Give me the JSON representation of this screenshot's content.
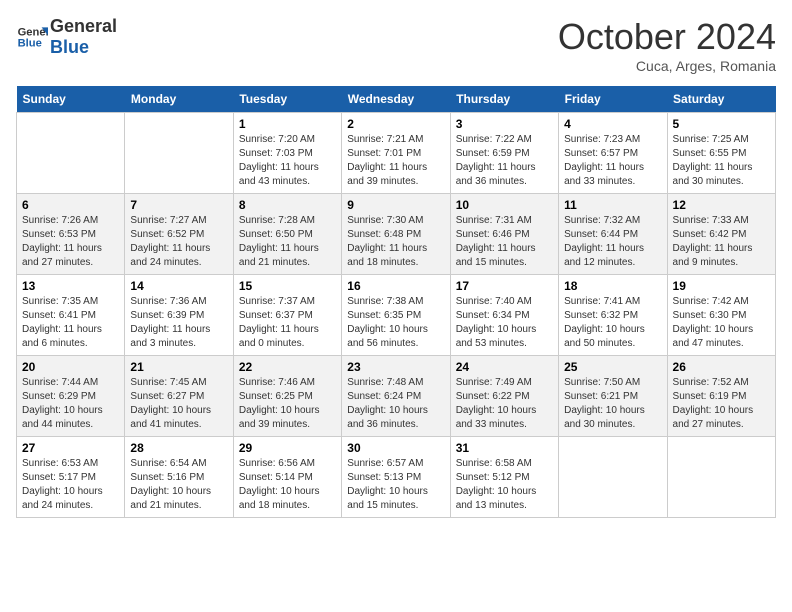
{
  "logo": {
    "line1": "General",
    "line2": "Blue"
  },
  "title": "October 2024",
  "subtitle": "Cuca, Arges, Romania",
  "days_of_week": [
    "Sunday",
    "Monday",
    "Tuesday",
    "Wednesday",
    "Thursday",
    "Friday",
    "Saturday"
  ],
  "weeks": [
    [
      {
        "num": "",
        "sunrise": "",
        "sunset": "",
        "daylight": ""
      },
      {
        "num": "",
        "sunrise": "",
        "sunset": "",
        "daylight": ""
      },
      {
        "num": "1",
        "sunrise": "Sunrise: 7:20 AM",
        "sunset": "Sunset: 7:03 PM",
        "daylight": "Daylight: 11 hours and 43 minutes."
      },
      {
        "num": "2",
        "sunrise": "Sunrise: 7:21 AM",
        "sunset": "Sunset: 7:01 PM",
        "daylight": "Daylight: 11 hours and 39 minutes."
      },
      {
        "num": "3",
        "sunrise": "Sunrise: 7:22 AM",
        "sunset": "Sunset: 6:59 PM",
        "daylight": "Daylight: 11 hours and 36 minutes."
      },
      {
        "num": "4",
        "sunrise": "Sunrise: 7:23 AM",
        "sunset": "Sunset: 6:57 PM",
        "daylight": "Daylight: 11 hours and 33 minutes."
      },
      {
        "num": "5",
        "sunrise": "Sunrise: 7:25 AM",
        "sunset": "Sunset: 6:55 PM",
        "daylight": "Daylight: 11 hours and 30 minutes."
      }
    ],
    [
      {
        "num": "6",
        "sunrise": "Sunrise: 7:26 AM",
        "sunset": "Sunset: 6:53 PM",
        "daylight": "Daylight: 11 hours and 27 minutes."
      },
      {
        "num": "7",
        "sunrise": "Sunrise: 7:27 AM",
        "sunset": "Sunset: 6:52 PM",
        "daylight": "Daylight: 11 hours and 24 minutes."
      },
      {
        "num": "8",
        "sunrise": "Sunrise: 7:28 AM",
        "sunset": "Sunset: 6:50 PM",
        "daylight": "Daylight: 11 hours and 21 minutes."
      },
      {
        "num": "9",
        "sunrise": "Sunrise: 7:30 AM",
        "sunset": "Sunset: 6:48 PM",
        "daylight": "Daylight: 11 hours and 18 minutes."
      },
      {
        "num": "10",
        "sunrise": "Sunrise: 7:31 AM",
        "sunset": "Sunset: 6:46 PM",
        "daylight": "Daylight: 11 hours and 15 minutes."
      },
      {
        "num": "11",
        "sunrise": "Sunrise: 7:32 AM",
        "sunset": "Sunset: 6:44 PM",
        "daylight": "Daylight: 11 hours and 12 minutes."
      },
      {
        "num": "12",
        "sunrise": "Sunrise: 7:33 AM",
        "sunset": "Sunset: 6:42 PM",
        "daylight": "Daylight: 11 hours and 9 minutes."
      }
    ],
    [
      {
        "num": "13",
        "sunrise": "Sunrise: 7:35 AM",
        "sunset": "Sunset: 6:41 PM",
        "daylight": "Daylight: 11 hours and 6 minutes."
      },
      {
        "num": "14",
        "sunrise": "Sunrise: 7:36 AM",
        "sunset": "Sunset: 6:39 PM",
        "daylight": "Daylight: 11 hours and 3 minutes."
      },
      {
        "num": "15",
        "sunrise": "Sunrise: 7:37 AM",
        "sunset": "Sunset: 6:37 PM",
        "daylight": "Daylight: 11 hours and 0 minutes."
      },
      {
        "num": "16",
        "sunrise": "Sunrise: 7:38 AM",
        "sunset": "Sunset: 6:35 PM",
        "daylight": "Daylight: 10 hours and 56 minutes."
      },
      {
        "num": "17",
        "sunrise": "Sunrise: 7:40 AM",
        "sunset": "Sunset: 6:34 PM",
        "daylight": "Daylight: 10 hours and 53 minutes."
      },
      {
        "num": "18",
        "sunrise": "Sunrise: 7:41 AM",
        "sunset": "Sunset: 6:32 PM",
        "daylight": "Daylight: 10 hours and 50 minutes."
      },
      {
        "num": "19",
        "sunrise": "Sunrise: 7:42 AM",
        "sunset": "Sunset: 6:30 PM",
        "daylight": "Daylight: 10 hours and 47 minutes."
      }
    ],
    [
      {
        "num": "20",
        "sunrise": "Sunrise: 7:44 AM",
        "sunset": "Sunset: 6:29 PM",
        "daylight": "Daylight: 10 hours and 44 minutes."
      },
      {
        "num": "21",
        "sunrise": "Sunrise: 7:45 AM",
        "sunset": "Sunset: 6:27 PM",
        "daylight": "Daylight: 10 hours and 41 minutes."
      },
      {
        "num": "22",
        "sunrise": "Sunrise: 7:46 AM",
        "sunset": "Sunset: 6:25 PM",
        "daylight": "Daylight: 10 hours and 39 minutes."
      },
      {
        "num": "23",
        "sunrise": "Sunrise: 7:48 AM",
        "sunset": "Sunset: 6:24 PM",
        "daylight": "Daylight: 10 hours and 36 minutes."
      },
      {
        "num": "24",
        "sunrise": "Sunrise: 7:49 AM",
        "sunset": "Sunset: 6:22 PM",
        "daylight": "Daylight: 10 hours and 33 minutes."
      },
      {
        "num": "25",
        "sunrise": "Sunrise: 7:50 AM",
        "sunset": "Sunset: 6:21 PM",
        "daylight": "Daylight: 10 hours and 30 minutes."
      },
      {
        "num": "26",
        "sunrise": "Sunrise: 7:52 AM",
        "sunset": "Sunset: 6:19 PM",
        "daylight": "Daylight: 10 hours and 27 minutes."
      }
    ],
    [
      {
        "num": "27",
        "sunrise": "Sunrise: 6:53 AM",
        "sunset": "Sunset: 5:17 PM",
        "daylight": "Daylight: 10 hours and 24 minutes."
      },
      {
        "num": "28",
        "sunrise": "Sunrise: 6:54 AM",
        "sunset": "Sunset: 5:16 PM",
        "daylight": "Daylight: 10 hours and 21 minutes."
      },
      {
        "num": "29",
        "sunrise": "Sunrise: 6:56 AM",
        "sunset": "Sunset: 5:14 PM",
        "daylight": "Daylight: 10 hours and 18 minutes."
      },
      {
        "num": "30",
        "sunrise": "Sunrise: 6:57 AM",
        "sunset": "Sunset: 5:13 PM",
        "daylight": "Daylight: 10 hours and 15 minutes."
      },
      {
        "num": "31",
        "sunrise": "Sunrise: 6:58 AM",
        "sunset": "Sunset: 5:12 PM",
        "daylight": "Daylight: 10 hours and 13 minutes."
      },
      {
        "num": "",
        "sunrise": "",
        "sunset": "",
        "daylight": ""
      },
      {
        "num": "",
        "sunrise": "",
        "sunset": "",
        "daylight": ""
      }
    ]
  ]
}
